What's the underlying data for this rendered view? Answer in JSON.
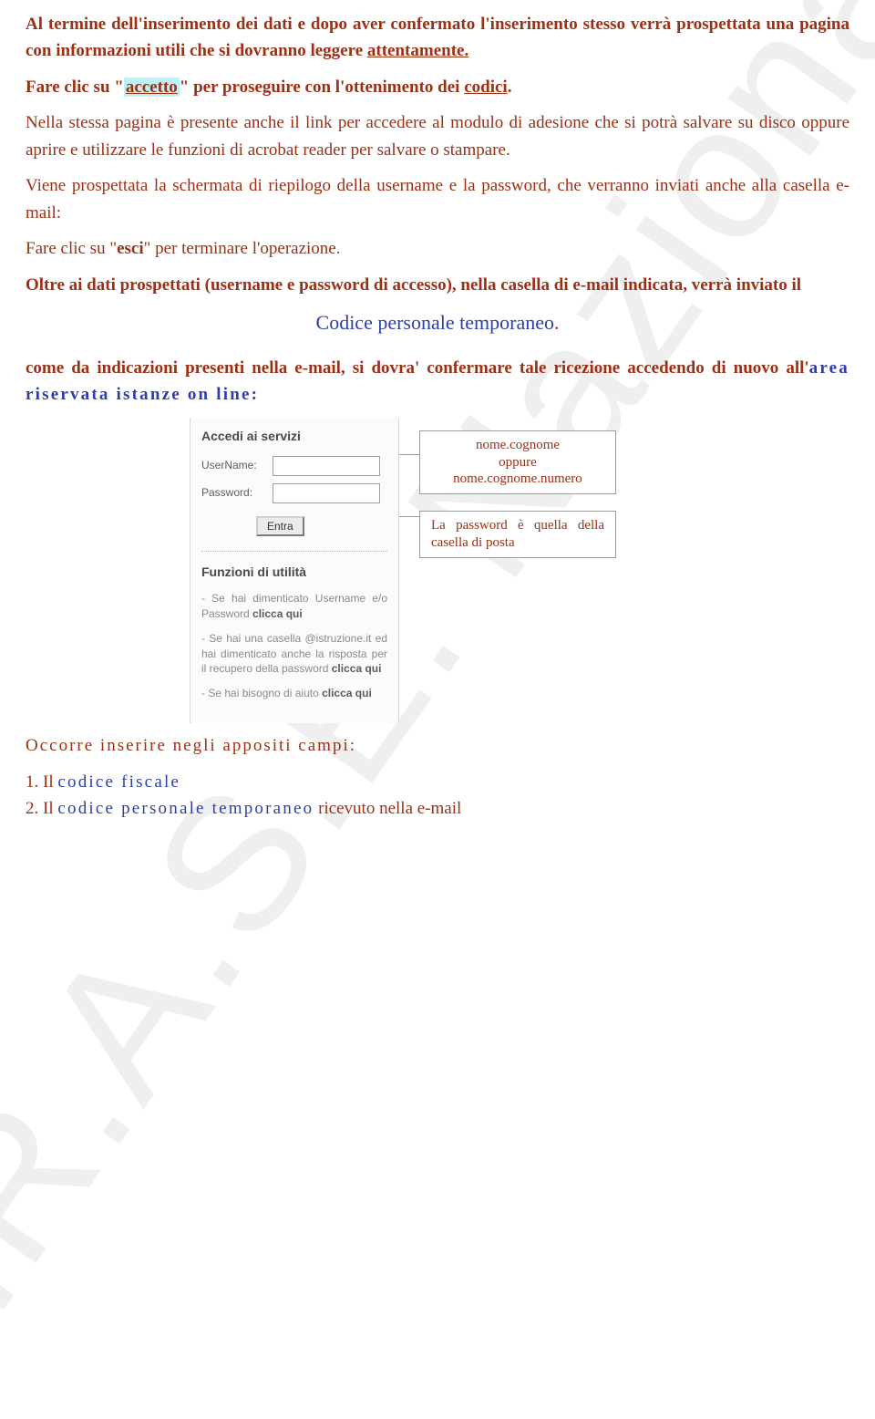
{
  "watermark": "I.R.A.S.E. Nazionale",
  "para": {
    "p1a": "Al termine dell'inserimento dei dati e dopo aver confermato l'inserimento stesso verrà prospettata una pagina con informazioni utili che si dovranno leggere ",
    "p1b": "attentamente.",
    "p2a": "Fare clic su \"",
    "p2b": "accetto",
    "p2c": "\" per proseguire con l'ottenimento dei ",
    "p2d": "codici",
    "p2e": ".",
    "p3": "Nella stessa pagina è presente anche il link per accedere al modulo di adesione che si potrà salvare su disco oppure aprire e utilizzare le funzioni di acrobat reader per salvare o stampare.",
    "p4": "Viene prospettata la schermata di riepilogo della username e la password, che verranno inviati anche alla casella e-mail:",
    "p5a": "Fare clic su \"",
    "p5b": "esci",
    "p5c": "\" per terminare l'operazione.",
    "p6": "Oltre ai dati prospettati (username e password di accesso), nella casella di e-mail indicata, verrà inviato il",
    "centered": "Codice personale temporaneo",
    "centered_dot": ".",
    "p7a": "come da indicazioni presenti nella e-mail, si dovra' confermare tale ricezione accedendo di nuovo all'",
    "p7b": "area riservata istanze on line:"
  },
  "login": {
    "title": "Accedi ai servizi",
    "user_label": "UserName:",
    "pass_label": "Password:",
    "button": "Entra"
  },
  "util": {
    "title": "Funzioni di utilità",
    "u1a": "- Se hai dimenticato Username e/o Password ",
    "u1b": "clicca qui",
    "u2a": "- Se hai una casella @istruzione.it ed hai dimenticato anche la risposta per il recupero della password ",
    "u2b": "clicca qui",
    "u3a": "- Se hai bisogno di aiuto ",
    "u3b": "clicca qui"
  },
  "callout": {
    "c1_line1": "nome.cognome",
    "c1_line2": "oppure",
    "c1_line3": "nome.cognome.numero",
    "c2": "La password è quella della casella di posta"
  },
  "footer": {
    "head": "Occorre inserire negli appositi campi:",
    "l1a": "1. Il ",
    "l1b": "codice fiscale",
    "l2a": "2. Il ",
    "l2b": "codice personale temporaneo",
    "l2c": " ricevuto nella e-mail"
  }
}
